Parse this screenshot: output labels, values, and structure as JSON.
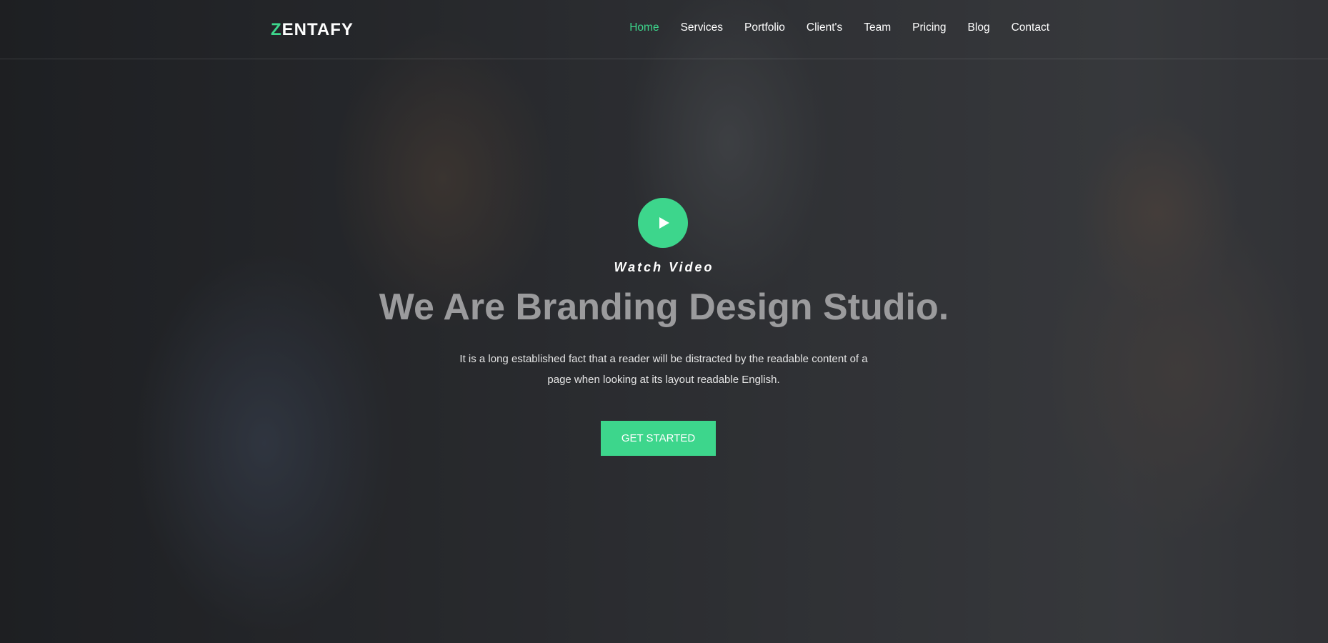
{
  "brand": {
    "logo_first": "Z",
    "logo_rest": "ENTAFY",
    "accent": "#3dd68c"
  },
  "nav": {
    "items": [
      {
        "label": "Home",
        "active": true
      },
      {
        "label": "Services"
      },
      {
        "label": "Portfolio"
      },
      {
        "label": "Client's"
      },
      {
        "label": "Team"
      },
      {
        "label": "Pricing"
      },
      {
        "label": "Blog"
      },
      {
        "label": "Contact"
      }
    ]
  },
  "hero": {
    "play_icon": "play-icon",
    "watch_label": "Watch Video",
    "title": "We Are Branding Design Studio.",
    "description": "It is a long established fact that a reader will be distracted by the readable content of a page when looking at its layout readable English.",
    "cta_label": "GET STARTED"
  }
}
